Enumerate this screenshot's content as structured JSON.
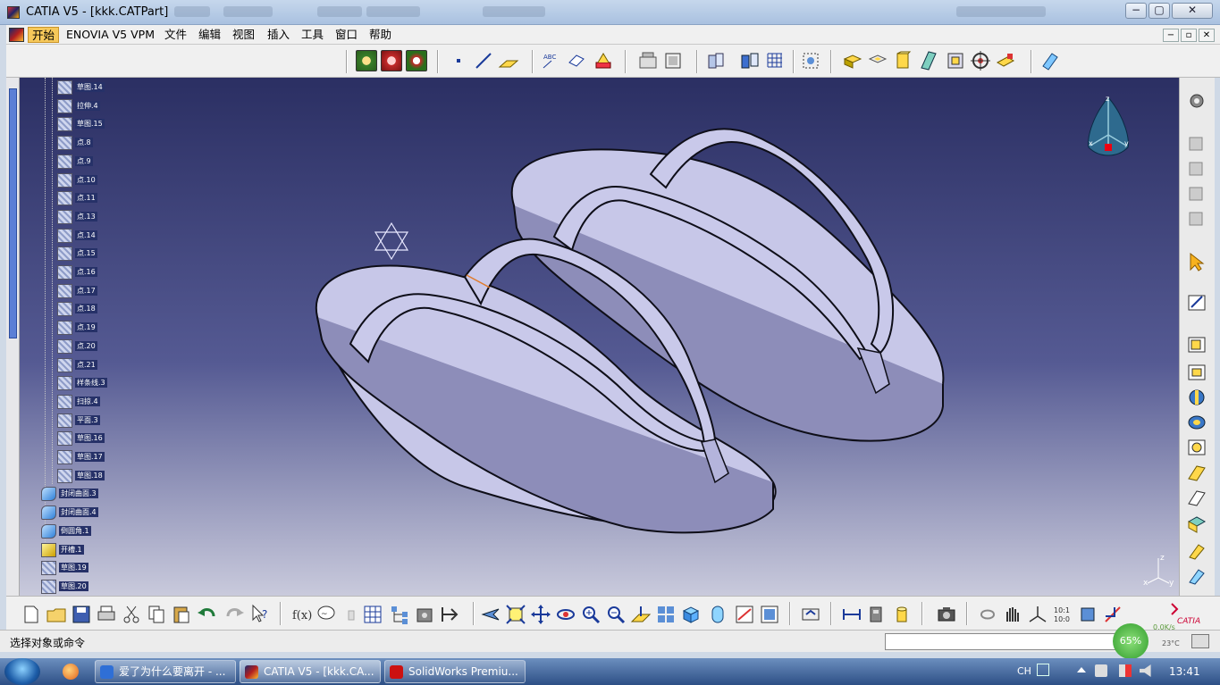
{
  "window": {
    "title": "CATIA V5 - [kkk.CATPart]",
    "controls": [
      "−",
      "▢",
      "✕"
    ]
  },
  "menubar": {
    "items": [
      "开始",
      "ENOVIA V5 VPM",
      "文件",
      "编辑",
      "视图",
      "插入",
      "工具",
      "窗口",
      "帮助"
    ],
    "mdi_controls": [
      "−",
      "▫",
      "✕"
    ]
  },
  "tree": {
    "items": [
      {
        "label": "草图.14",
        "icon": "sketch-icon"
      },
      {
        "label": "拉伸.4",
        "icon": "extrude-icon"
      },
      {
        "label": "草图.15",
        "icon": "sketch-icon"
      },
      {
        "label": "点.8",
        "icon": "point-icon"
      },
      {
        "label": "点.9",
        "icon": "point-icon"
      },
      {
        "label": "点.10",
        "icon": "point-icon"
      },
      {
        "label": "点.11",
        "icon": "point-icon"
      },
      {
        "label": "点.13",
        "icon": "point-icon"
      },
      {
        "label": "点.14",
        "icon": "point-icon"
      },
      {
        "label": "点.15",
        "icon": "point-icon"
      },
      {
        "label": "点.16",
        "icon": "point-icon"
      },
      {
        "label": "点.17",
        "icon": "point-icon"
      },
      {
        "label": "点.18",
        "icon": "point-icon"
      },
      {
        "label": "点.19",
        "icon": "point-icon"
      },
      {
        "label": "点.20",
        "icon": "point-icon"
      },
      {
        "label": "点.21",
        "icon": "point-icon"
      },
      {
        "label": "样条线.3",
        "icon": "spline-icon"
      },
      {
        "label": "扫掠.4",
        "icon": "sweep-icon"
      },
      {
        "label": "平面.3",
        "icon": "plane-icon"
      },
      {
        "label": "草图.16",
        "icon": "sketch-icon"
      },
      {
        "label": "草图.17",
        "icon": "sketch-icon"
      },
      {
        "label": "草图.18",
        "icon": "sketch-icon"
      },
      {
        "label": "封闭曲面.3",
        "icon": "close-surface-icon"
      },
      {
        "label": "封闭曲面.4",
        "icon": "close-surface-icon"
      },
      {
        "label": "倒圆角.1",
        "icon": "fillet-icon"
      },
      {
        "label": "开槽.1",
        "icon": "pocket-icon"
      },
      {
        "label": "草图.19",
        "icon": "sketch-icon"
      },
      {
        "label": "草图.20",
        "icon": "sketch-icon"
      }
    ]
  },
  "compass": {
    "axes": [
      "z",
      "x",
      "y"
    ]
  },
  "axis_triad": {
    "labels": [
      "z",
      "x",
      "y"
    ]
  },
  "status": {
    "prompt": "选择对象或命令",
    "command_input": ""
  },
  "overlay_widget": {
    "percent": "65%",
    "speed": "0.0K/s",
    "temp": "23°C"
  },
  "taskbar": {
    "tasks": [
      {
        "label": "爱了为什么要离开 - ...",
        "color": "#2f6fd6"
      },
      {
        "label": "CATIA V5 - [kkk.CA...",
        "color": "#a33"
      },
      {
        "label": "SolidWorks Premiu...",
        "color": "#c11"
      }
    ],
    "lang": "CH",
    "time": "13:41"
  },
  "colors": {
    "viewport_top": "#2b2f63",
    "viewport_bottom": "#c9cadc",
    "model_face": "#c9c9ea",
    "model_edge": "#0e0e18"
  }
}
